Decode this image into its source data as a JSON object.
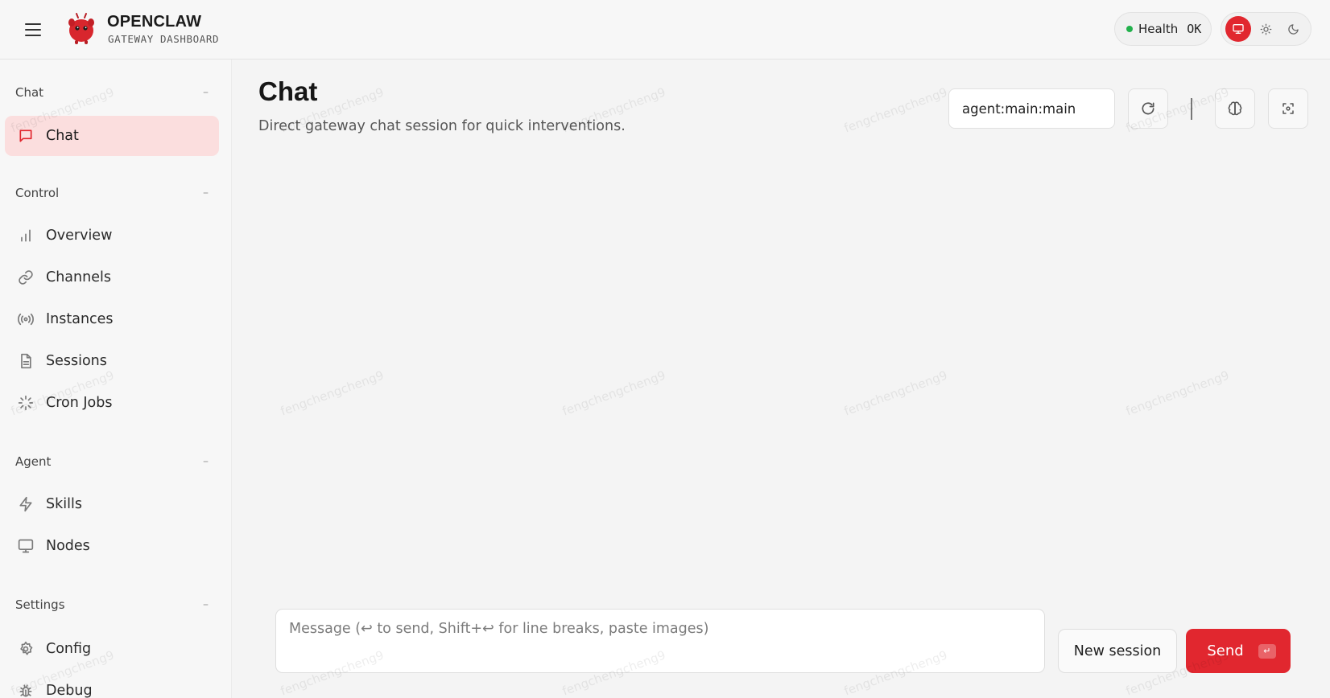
{
  "header": {
    "brand_title": "OPENCLAW",
    "brand_subtitle": "GATEWAY DASHBOARD",
    "health_label": "Health",
    "health_value": "OK"
  },
  "sidebar": {
    "groups": [
      {
        "label": "Chat",
        "items": [
          {
            "label": "Chat",
            "icon": "message-square-icon",
            "active": true
          }
        ]
      },
      {
        "label": "Control",
        "items": [
          {
            "label": "Overview",
            "icon": "bar-chart-icon"
          },
          {
            "label": "Channels",
            "icon": "link-icon"
          },
          {
            "label": "Instances",
            "icon": "radio-broadcast-icon"
          },
          {
            "label": "Sessions",
            "icon": "file-text-icon"
          },
          {
            "label": "Cron Jobs",
            "icon": "loader-icon"
          }
        ]
      },
      {
        "label": "Agent",
        "items": [
          {
            "label": "Skills",
            "icon": "lightning-icon"
          },
          {
            "label": "Nodes",
            "icon": "monitor-icon"
          }
        ]
      },
      {
        "label": "Settings",
        "items": [
          {
            "label": "Config",
            "icon": "gear-icon"
          },
          {
            "label": "Debug",
            "icon": "bug-icon"
          }
        ]
      }
    ]
  },
  "main": {
    "title": "Chat",
    "subtitle": "Direct gateway chat session for quick interventions.",
    "session_key": "agent:main:main",
    "composer_placeholder": "Message (↩ to send, Shift+↩ for line breaks, paste images)",
    "new_session_label": "New session",
    "send_label": "Send",
    "send_hint": "↵"
  },
  "watermark": "fengchengcheng9",
  "colors": {
    "accent": "#e1272f",
    "active_nav_bg": "#fbdede",
    "health_ok": "#22b14c"
  }
}
